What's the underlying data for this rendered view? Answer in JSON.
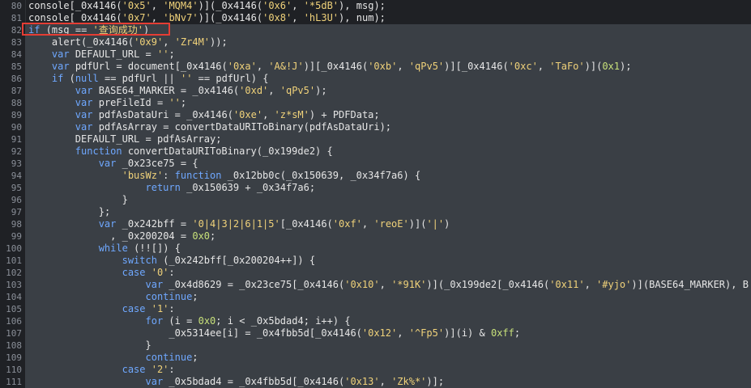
{
  "editor": {
    "lines": [
      {
        "n": "80",
        "text": "console[_0x4146('0x5', 'MQM4')](_0x4146('0x6', '*5dB'), msg);"
      },
      {
        "n": "81",
        "text": "console[_0x4146('0x7', 'bNv7')](_0x4146('0x8', 'hL3U'), num);"
      },
      {
        "n": "82",
        "text": "if (msg == '查询成功')"
      },
      {
        "n": "83",
        "text": "    alert(_0x4146('0x9', 'Zr4M'));"
      },
      {
        "n": "84",
        "text": "    var DEFAULT_URL = '';"
      },
      {
        "n": "85",
        "text": "    var pdfUrl = document[_0x4146('0xa', 'A&!J')][_0x4146('0xb', 'qPv5')][_0x4146('0xc', 'TaFo')](0x1);"
      },
      {
        "n": "86",
        "text": "    if (null == pdfUrl || '' == pdfUrl) {"
      },
      {
        "n": "87",
        "text": "        var BASE64_MARKER = _0x4146('0xd', 'qPv5');"
      },
      {
        "n": "88",
        "text": "        var preFileId = '';"
      },
      {
        "n": "89",
        "text": "        var pdfAsDataUri = _0x4146('0xe', 'z*sM') + PDFData;"
      },
      {
        "n": "90",
        "text": "        var pdfAsArray = convertDataURIToBinary(pdfAsDataUri);"
      },
      {
        "n": "91",
        "text": "        DEFAULT_URL = pdfAsArray;"
      },
      {
        "n": "92",
        "text": "        function convertDataURIToBinary(_0x199de2) {"
      },
      {
        "n": "93",
        "text": "            var _0x23ce75 = {"
      },
      {
        "n": "94",
        "text": "                'busWz': function _0x12bb0c(_0x150639, _0x34f7a6) {"
      },
      {
        "n": "95",
        "text": "                    return _0x150639 + _0x34f7a6;"
      },
      {
        "n": "96",
        "text": "                }"
      },
      {
        "n": "97",
        "text": "            };"
      },
      {
        "n": "98",
        "text": "            var _0x242bff = '0|4|3|2|6|1|5'[_0x4146('0xf', 'reoE')]('|')"
      },
      {
        "n": "99",
        "text": "              , _0x200204 = 0x0;"
      },
      {
        "n": "100",
        "text": "            while (!![]) {"
      },
      {
        "n": "101",
        "text": "                switch (_0x242bff[_0x200204++]) {"
      },
      {
        "n": "102",
        "text": "                case '0':"
      },
      {
        "n": "103",
        "text": "                    var _0x4d8629 = _0x23ce75[_0x4146('0x10', '*91K')](_0x199de2[_0x4146('0x11', '#yjo')](BASE64_MARKER), B"
      },
      {
        "n": "104",
        "text": "                    continue;"
      },
      {
        "n": "105",
        "text": "                case '1':"
      },
      {
        "n": "106",
        "text": "                    for (i = 0x0; i < _0x5bdad4; i++) {"
      },
      {
        "n": "107",
        "text": "                        _0x5314ee[i] = _0x4fbb5d[_0x4146('0x12', '^Fp5')](i) & 0xff;"
      },
      {
        "n": "108",
        "text": "                    }"
      },
      {
        "n": "109",
        "text": "                    continue;"
      },
      {
        "n": "110",
        "text": "                case '2':"
      },
      {
        "n": "111",
        "text": "                    var _0x5bdad4 = _0x4fbb5d[_0x4146('0x13', 'Zk%*')];"
      }
    ],
    "selected_from": 2
  }
}
